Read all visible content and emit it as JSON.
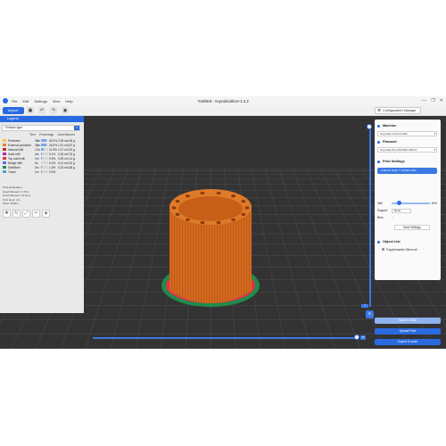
{
  "window": {
    "title": "*Untitled - AnycubicSlicer-1.2.2",
    "menu": [
      "File",
      "Edit",
      "Settings",
      "View",
      "Help"
    ],
    "controls": [
      "—",
      "❐",
      "✕"
    ]
  },
  "toolbar": {
    "import_label": "Import",
    "config_label": "Configuration Manage"
  },
  "legend": {
    "header": "Legend",
    "feature_type": "Feature type",
    "columns": [
      "Time",
      "Percentage",
      "Used filament"
    ],
    "rows": [
      {
        "name": "Perimeter",
        "color": "#f5c542",
        "time": "38m",
        "pct": 26.3,
        "pct_label": "26.3%",
        "len": "2.39 m",
        "wt": "6.08 g"
      },
      {
        "name": "External perimeter",
        "color": "#e8842b",
        "time": "38m",
        "pct": 26.0,
        "pct_label": "26.0%",
        "len": "2.31 m",
        "wt": "6.87 g"
      },
      {
        "name": "Internal infill",
        "color": "#b6342e",
        "time": "17m",
        "pct": 11.9,
        "pct_label": "11.9%",
        "len": "1.07 m",
        "wt": "3.20 g"
      },
      {
        "name": "Solid infill",
        "color": "#a82fb0",
        "time": "4m",
        "pct": 3.1,
        "pct_label": "3.1%",
        "len": "0.26 m",
        "wt": "0.78 g"
      },
      {
        "name": "Top solid infill",
        "color": "#e0344a",
        "time": "1m",
        "pct": 0.9,
        "pct_label": "0.9%",
        "len": "0.05 m",
        "wt": "0.14 g"
      },
      {
        "name": "Bridge infill",
        "color": "#5a6ee6",
        "time": "0s",
        "pct": 0.2,
        "pct_label": "0.2%",
        "len": "0.01 m",
        "wt": "0.02 g"
      },
      {
        "name": "Skirt/Brim",
        "color": "#1f8c4a",
        "time": "2m",
        "pct": 1.6,
        "pct_label": "1.6%",
        "len": "0.23 m",
        "wt": "0.68 g"
      },
      {
        "name": "Travel",
        "color": "#4aa0d8",
        "time": "1m",
        "pct": 0.9,
        "pct_label": "0.9%",
        "len": "",
        "wt": ""
      }
    ],
    "summary": [
      "Print Estimation",
      "Used filament: 4.78 m",
      "Used filament: 14.23 g",
      "First layer: 2m",
      "Total: 1h32m"
    ]
  },
  "right_panel": {
    "machine_title": "Machine",
    "machine_value": "Anycubic Kobra 2 Max",
    "filament_title": "Filament",
    "filament_value": "Anycubic PLA #ACSM-V2Fil 0",
    "print_settings_title": "Print Settings",
    "print_profile": "0.20mm Draft ** ACSM-V2Fil",
    "params": [
      {
        "label": "Infill",
        "value": "20%"
      },
      {
        "label": "Support",
        "value": "None"
      },
      {
        "label": "Brim",
        "value": "✓"
      }
    ],
    "infill_fraction": 0.15,
    "more_settings": "More Settings",
    "object_list_title": "Object List",
    "object_item": "Pappbehaelter-55mm.stl"
  },
  "actions": {
    "send": "Back to Slice",
    "export": "Export G-code",
    "upload": "Upload Print"
  },
  "slider": {
    "layer_top": "130",
    "layer_bottom": "1",
    "move": "25"
  },
  "colors": {
    "accent": "#2a6ae0",
    "bed": "#2e2e2e"
  }
}
